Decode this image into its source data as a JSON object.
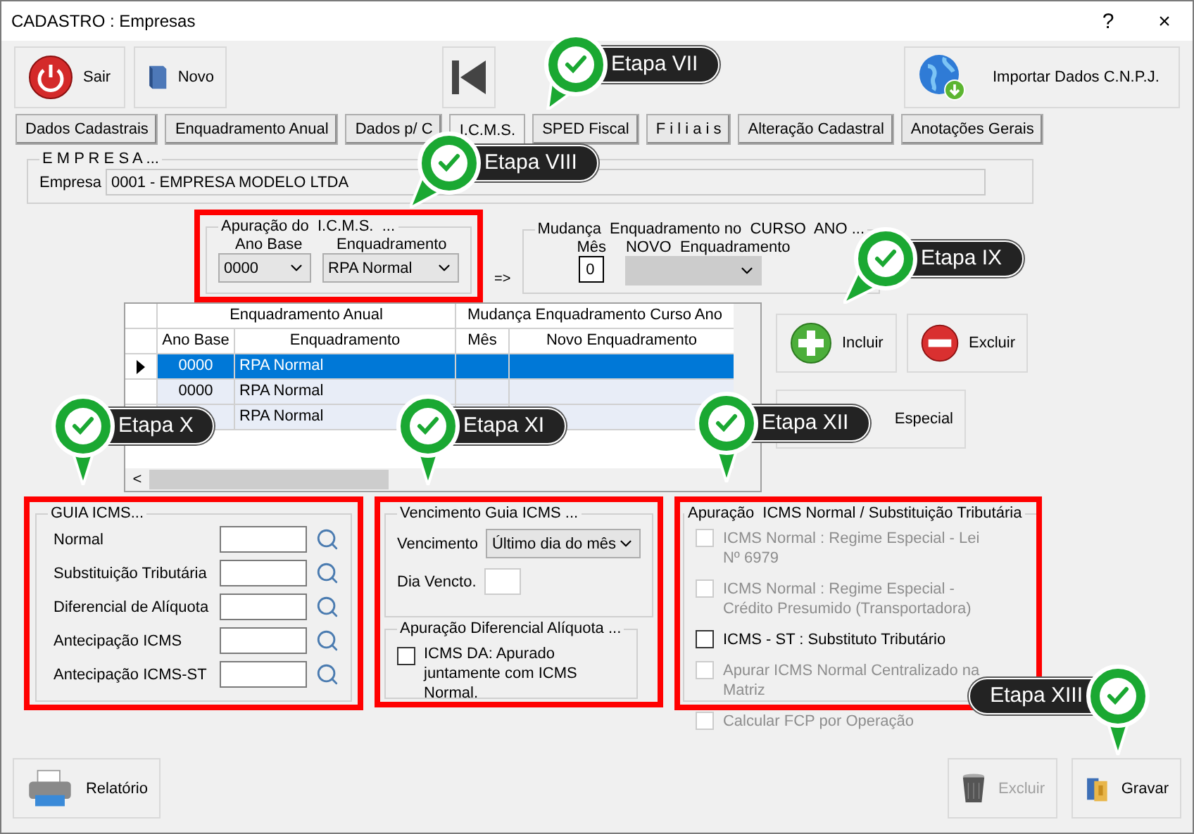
{
  "window": {
    "title": "CADASTRO : Empresas",
    "help": "?",
    "close": "×"
  },
  "toolbar": {
    "buttons": [
      {
        "label": "Sair",
        "kind": "power"
      },
      {
        "label": "Novo",
        "kind": "book"
      }
    ],
    "import": "Importar Dados C.N.P.J."
  },
  "tabs": [
    {
      "label": "Dados Cadastrais",
      "selected": false
    },
    {
      "label": "Enquadramento Anual",
      "selected": false
    },
    {
      "label": "Dados p/ C",
      "selected": false
    },
    {
      "label": "I.C.M.S.",
      "selected": true
    },
    {
      "label": "SPED Fiscal",
      "selected": false
    },
    {
      "label": "F i l i a i s",
      "selected": false
    },
    {
      "label": "Alteração Cadastral",
      "selected": false
    },
    {
      "label": "Anotações Gerais",
      "selected": false
    }
  ],
  "empresa": {
    "legend": "E M P R E S A ...",
    "label": "Empresa",
    "value": "0001 - EMPRESA MODELO LTDA"
  },
  "apuracao": {
    "legend": "Apuração do  I.C.M.S.  ...",
    "ano_label": "Ano Base",
    "ano": "0000",
    "enq_label": "Enquadramento",
    "enq": "RPA Normal"
  },
  "arrow": "=>",
  "mudanca": {
    "legend": "Mudança  Enquadramento no  CURSO  ANO ...",
    "mes_label": "Mês",
    "mes": "0",
    "novo_label": "NOVO  Enquadramento"
  },
  "grid": {
    "groups": [
      "Enquadramento Anual",
      "Mudança Enquadramento Curso Ano"
    ],
    "columns": [
      "Ano Base",
      "Enquadramento",
      "Mês",
      "Novo Enquadramento"
    ],
    "scroll_left": "<",
    "rows": [
      {
        "ano": "0000",
        "enq": "RPA Normal",
        "selected": true
      },
      {
        "ano": "0000",
        "enq": "RPA Normal",
        "selected": false
      },
      {
        "enq": "RPA Normal",
        "selected": false
      }
    ]
  },
  "side_buttons": [
    {
      "label": "Incluir",
      "kind": "plus"
    },
    {
      "label": "Excluir",
      "kind": "minus"
    },
    {
      "label": "Especial",
      "kind": "plain"
    }
  ],
  "guia": {
    "legend": "GUIA ICMS...",
    "fields": [
      "Normal",
      "Substituição Tributária",
      "Diferencial de Alíquota",
      "Antecipação ICMS",
      "Antecipação ICMS-ST"
    ]
  },
  "vencimento": {
    "legend": "Vencimento Guia ICMS ...",
    "venc_label": "Vencimento",
    "venc": "Último dia do mês",
    "dia_label": "Dia Vencto.",
    "dif_legend": "Apuração Diferencial Alíquota ...",
    "dif_check": {
      "label": "ICMS DA: Apurado juntamente com ICMS Normal.",
      "checked": false
    }
  },
  "apuracao_st": {
    "legend": "Apuração  ICMS Normal / Substituição Tributária",
    "options": [
      {
        "label": "ICMS Normal : Regime Especial - Lei Nº 6979",
        "checked": false,
        "disabled": true
      },
      {
        "label": "ICMS Normal : Regime Especial - Crédito Presumido (Transportadora)",
        "checked": false,
        "disabled": true
      },
      {
        "label": "ICMS - ST : Substituto Tributário",
        "checked": false,
        "disabled": false
      },
      {
        "label": "Apurar ICMS Normal Centralizado na Matriz",
        "checked": false,
        "disabled": true
      },
      {
        "label": "Calcular FCP por Operação",
        "checked": false,
        "disabled": true
      }
    ]
  },
  "bottom": [
    {
      "label": "Relatório",
      "kind": "printer",
      "disabled": false
    },
    {
      "label": "Excluir",
      "kind": "trash",
      "disabled": true
    },
    {
      "label": "Gravar",
      "kind": "folder",
      "disabled": false
    }
  ],
  "callouts": [
    "Etapa VII",
    "Etapa VIII",
    "Etapa IX",
    "Etapa X",
    "Etapa XI",
    "Etapa XII",
    "Etapa XIII"
  ]
}
